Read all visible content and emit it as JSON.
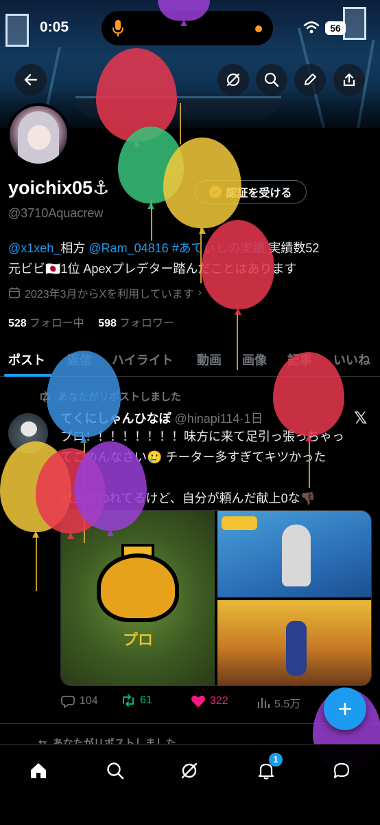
{
  "status_bar": {
    "time": "0:05",
    "battery": "56"
  },
  "profile": {
    "display_name": "yoichix05",
    "name_emoji": "⚓",
    "handle": "@3710Aquacrew",
    "verify_button": "認証を受ける",
    "bio": {
      "mention1": "@x1xeh_",
      "text1": "相方 ",
      "mention2": "@Ram_04816",
      "hashtag": " #あてぃしの実績",
      "text2": " 実績数52",
      "line2": "元ビビ🇯🇵1位 Apexプレデター踏んだことはあります"
    },
    "joined": "2023年3月からXを利用しています",
    "following_count": "528",
    "following_label": "フォロー中",
    "followers_count": "598",
    "followers_label": "フォロワー"
  },
  "tabs": [
    {
      "label": "ポスト"
    },
    {
      "label": "返信"
    },
    {
      "label": "ハイライト"
    },
    {
      "label": "動画"
    },
    {
      "label": "画像"
    },
    {
      "label": "記事"
    },
    {
      "label": "いいね"
    }
  ],
  "post": {
    "repost_context": "あなたがリポストしました",
    "author_name": "てくにしゃんひなぽ",
    "author_handle": "@hinapi114",
    "time": "1日",
    "text_line1": "プロ！！！！！！！！味方に来て足引っ張っちゃっ",
    "text_line2": "てごめんなさい🥲 チーター多すぎてキツかった",
    "text_line3": "",
    "text_line4": "献上言われてるけど、自分が頼んだ献上0な👎🏿",
    "media_label": "プロ",
    "replies": "104",
    "reposts": "61",
    "likes": "322",
    "views": "5.5万"
  },
  "next_post": {
    "repost_context": "あなたがリポストしました"
  },
  "nav": {
    "notifications_badge": "1"
  },
  "colors": {
    "accent": "#1d9bf0",
    "repost": "#00ba7c",
    "like": "#f91880",
    "muted": "#71767b"
  }
}
